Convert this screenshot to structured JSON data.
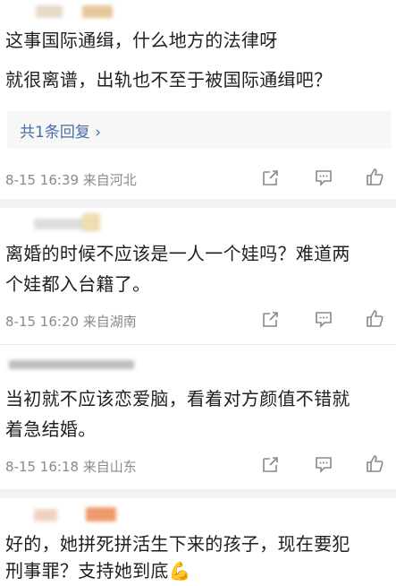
{
  "comments": [
    {
      "lines": [
        "这事国际通缉，什么地方的法律呀",
        "就很离谱，出轨也不至于被国际通缉吧？"
      ],
      "reply_link": "共1条回复 ›",
      "meta": "8-15 16:39 来自河北"
    },
    {
      "lines": [
        "离婚的时候不应该是一人一个娃吗？难道两",
        "个娃都入台籍了。"
      ],
      "meta": "8-15 16:20 来自湖南"
    },
    {
      "lines": [
        "当初就不应该恋爱脑，看着对方颜值不错就",
        "着急结婚。"
      ],
      "meta": "8-15 16:18 来自山东"
    },
    {
      "lines": [
        "好的，她拼死拼活生下来的孩子，现在要犯",
        "刑事罪？支持她到底💪"
      ]
    }
  ],
  "icons": [
    "share-icon",
    "comment-icon",
    "like-icon"
  ],
  "colors": {
    "link": "#4a6ea8",
    "meta": "#8a8a8a",
    "separator": "#f2f2f2"
  }
}
